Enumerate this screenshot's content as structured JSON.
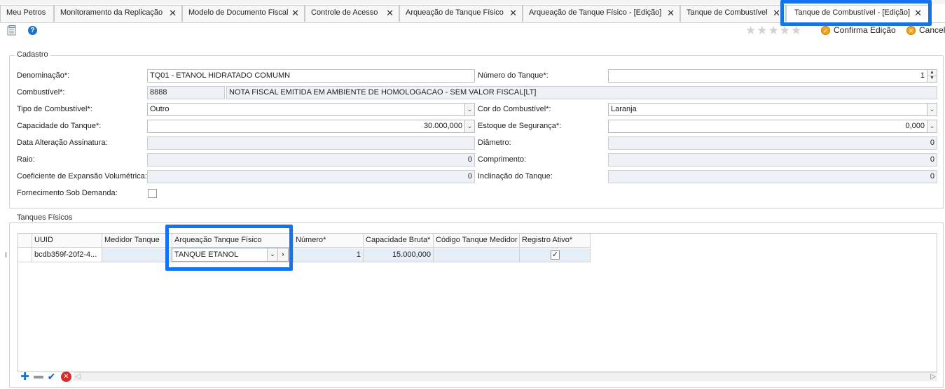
{
  "tabs": [
    {
      "label": "Meu Petros",
      "closable": false
    },
    {
      "label": "Monitoramento da Replicação",
      "closable": true
    },
    {
      "label": "Modelo de Documento Fiscal",
      "closable": true
    },
    {
      "label": "Controle de Acesso",
      "closable": true
    },
    {
      "label": "Arqueação de Tanque Físico",
      "closable": true
    },
    {
      "label": "Arqueação de Tanque Físico - [Edição]",
      "closable": true
    },
    {
      "label": "Tanque de Combustível",
      "closable": true
    },
    {
      "label": "Tanque de Combustível - [Edição]",
      "closable": true,
      "active": true
    }
  ],
  "toolbar": {
    "help_icon": "?",
    "rating_stars": "★★★★★",
    "confirm_label": "Confirma Edição",
    "cancel_label": "Cancel"
  },
  "cadastro": {
    "legend": "Cadastro",
    "denominacao_label": "Denominação*:",
    "denominacao_value": "TQ01 - ETANOL HIDRATADO COMUMN",
    "numero_tanque_label": "Número do Tanque*:",
    "numero_tanque_value": "1",
    "combustivel_label": "Combustível*:",
    "combustivel_code": "8888",
    "combustivel_desc": "NOTA FISCAL EMITIDA EM AMBIENTE DE HOMOLOGACAO - SEM VALOR FISCAL[LT]",
    "tipo_combustivel_label": "Tipo de Combustível*:",
    "tipo_combustivel_value": "Outro",
    "cor_combustivel_label": "Cor do Combustível*:",
    "cor_combustivel_value": "Laranja",
    "capacidade_label": "Capacidade do Tanque*:",
    "capacidade_value": "30.000,000",
    "estoque_label": "Estoque de Segurança*:",
    "estoque_value": "0,000",
    "data_alteracao_label": "Data Alteração Assinatura:",
    "data_alteracao_value": "",
    "diametro_label": "Diâmetro:",
    "diametro_value": "0",
    "raio_label": "Raio:",
    "raio_value": "0",
    "comprimento_label": "Comprimento:",
    "comprimento_value": "0",
    "coeficiente_label": "Coeficiente de Expansão Volumétrica:",
    "coeficiente_value": "0",
    "inclinacao_label": "Inclinação do Tanque:",
    "inclinacao_value": "0",
    "fornecimento_label": "Fornecimento Sob Demanda:",
    "fornecimento_checked": false
  },
  "tanques": {
    "legend": "Tanques Físicos",
    "columns": [
      "UUID",
      "Medidor Tanque",
      "Arqueação Tanque Físico",
      "Número*",
      "Capacidade Bruta*",
      "Código Tanque Medidor",
      "Registro Ativo*"
    ],
    "rows": [
      {
        "uuid": "bcdb359f-20f2-4...",
        "medidor": "",
        "arqueacao": "TANQUE ETANOL",
        "numero": "1",
        "capacidade": "15.000,000",
        "codigo": "",
        "ativo": true
      }
    ]
  },
  "colors": {
    "highlight": "#1673f0",
    "readonly_bg": "#eef2f6"
  }
}
